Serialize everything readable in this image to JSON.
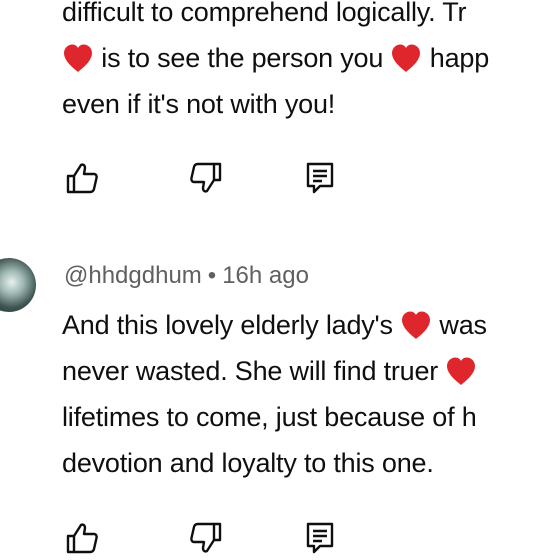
{
  "comment1": {
    "lines": [
      {
        "before": "difficult to comprehend logically. Tr",
        "heart": false,
        "after": ""
      },
      {
        "before": "",
        "heart": true,
        "middle": " is to see the person you ",
        "heart2": true,
        "after": " happ"
      },
      {
        "before": "even if it's not with you!",
        "heart": false,
        "after": ""
      }
    ]
  },
  "comment2": {
    "author": "@hhdgdhum",
    "separator": "•",
    "time": "16h ago",
    "lines": [
      {
        "before": "And this lovely elderly lady's ",
        "heart": true,
        "after": " was"
      },
      {
        "before": "never wasted. She will find truer ",
        "heart": true,
        "after": ""
      },
      {
        "before": "lifetimes to come, just because of h",
        "heart": false,
        "after": ""
      },
      {
        "before": "devotion and loyalty to this one.",
        "heart": false,
        "after": ""
      }
    ]
  },
  "icons": {
    "like": "thumbs-up-icon",
    "dislike": "thumbs-down-icon",
    "reply": "reply-comment-icon",
    "heart": "red-heart-emoji",
    "heart_color": "#e0262d"
  },
  "colors": {
    "text": "#0f0f0f",
    "meta": "#606060",
    "icon": "#0f0f0f"
  }
}
